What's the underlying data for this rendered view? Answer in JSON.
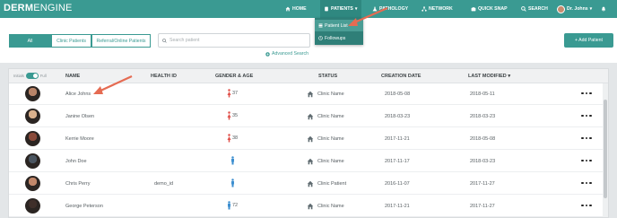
{
  "app": {
    "logo_bold": "DERM",
    "logo_rest": "ENGINE"
  },
  "nav": {
    "home": "HOME",
    "patients": "PATIENTS",
    "pathology": "PATHOLOGY",
    "network": "NETWORK",
    "quick_snap": "QUICK SNAP",
    "search": "SEARCH",
    "user": "Dr. Johns"
  },
  "dropdown": {
    "items": [
      "Patient List",
      "Followups"
    ]
  },
  "filters": {
    "tabs": [
      "All",
      "Clinic Patients",
      "Referral/Online Patients"
    ],
    "search_placeholder": "Search patient",
    "advanced": "Advanced Search",
    "add": "+ Add Patient"
  },
  "table": {
    "toggle_left": "Initials",
    "toggle_right": "Full",
    "columns": [
      "NAME",
      "HEALTH ID",
      "GENDER & AGE",
      "STATUS",
      "CREATION DATE",
      "LAST MODIFIED"
    ],
    "sort_indicator": "▾",
    "rows": [
      {
        "name": "Alice Johns",
        "health_id": "",
        "gender": "female",
        "age": "37",
        "status": "Clinic Name",
        "created": "2018-05-08",
        "modified": "2018-05-11"
      },
      {
        "name": "Janine Olsen",
        "health_id": "",
        "gender": "female",
        "age": "35",
        "status": "Clinic Name",
        "created": "2018-03-23",
        "modified": "2018-03-23"
      },
      {
        "name": "Kerrie Moore",
        "health_id": "",
        "gender": "female",
        "age": "38",
        "status": "Clinic Name",
        "created": "2017-11-21",
        "modified": "2018-05-08"
      },
      {
        "name": "John Doe",
        "health_id": "",
        "gender": "male",
        "age": "",
        "status": "Clinic Name",
        "created": "2017-11-17",
        "modified": "2018-03-23"
      },
      {
        "name": "Chris Perry",
        "health_id": "demo_id",
        "gender": "male",
        "age": "",
        "status": "Clinic Patient",
        "created": "2016-11-07",
        "modified": "2017-11-27"
      },
      {
        "name": "George Peterson",
        "health_id": "",
        "gender": "male",
        "age": "72",
        "status": "Clinic Name",
        "created": "2017-11-21",
        "modified": "2017-11-27"
      }
    ]
  },
  "colors": {
    "brand": "#3a9a92",
    "female": "#e0504a",
    "male": "#3d8fd0"
  },
  "icons": [
    "home-icon",
    "patients-icon",
    "pathology-icon",
    "network-icon",
    "camera-icon",
    "search-icon",
    "bell-icon",
    "list-icon",
    "followups-icon",
    "home-status-icon",
    "more-icon",
    "female-icon",
    "male-icon",
    "plus-icon"
  ]
}
